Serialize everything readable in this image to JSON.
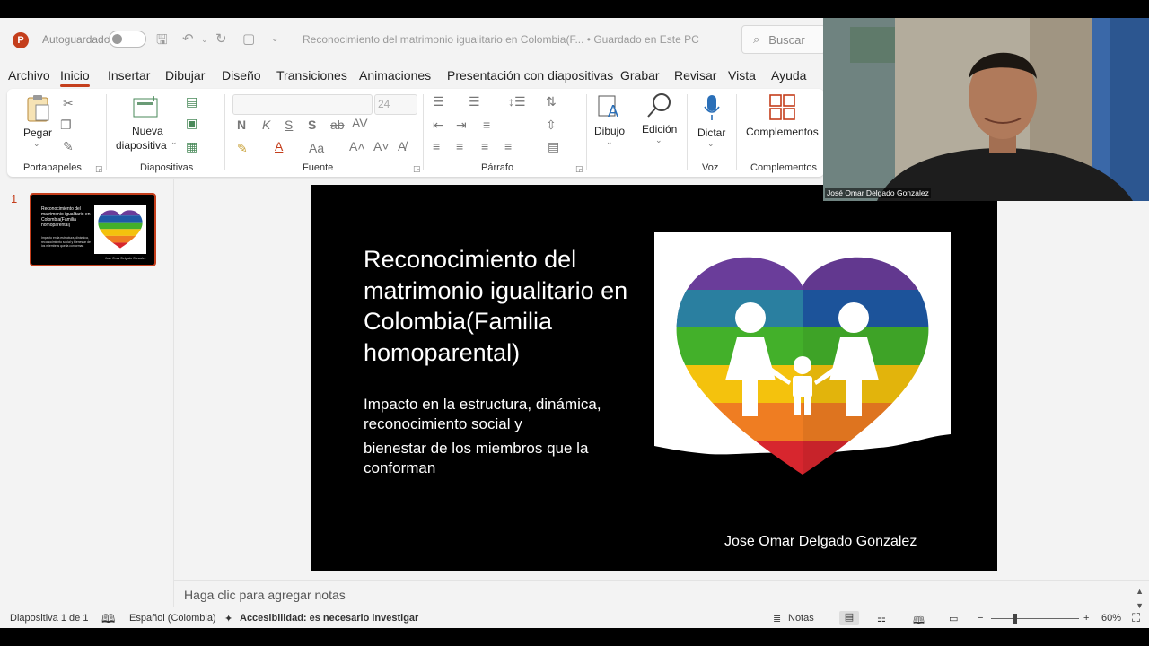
{
  "app": {
    "autosave_label": "Autoguardado",
    "document_title": "Reconocimiento del matrimonio igualitario en Colombia(F... • Guardado en Este PC",
    "search_label": "Buscar"
  },
  "tabs": [
    "Archivo",
    "Inicio",
    "Insertar",
    "Dibujar",
    "Diseño",
    "Transiciones",
    "Animaciones",
    "Presentación con diapositivas",
    "Grabar",
    "Revisar",
    "Vista",
    "Ayuda"
  ],
  "ribbon": {
    "paste_label": "Pegar",
    "new_slide_label_1": "Nueva",
    "new_slide_label_2": "diapositiva",
    "font_size": "24",
    "draw_label": "Dibujo",
    "edit_label": "Edición",
    "dictate_label": "Dictar",
    "addins_label": "Complementos",
    "groups": {
      "clipboard": "Portapapeles",
      "slides": "Diapositivas",
      "font": "Fuente",
      "paragraph": "Párrafo",
      "voice": "Voz",
      "addins": "Complementos"
    }
  },
  "thumbnail": {
    "number": "1",
    "title": "Reconocimiento del matrimonio igualitario en Colombia(Familia homoparental)",
    "subtitle": "Impacto en la estructura, dinámica, reconocimiento social y bienestar de los miembros que la conforman",
    "author": "Jose Omar Delgado Gonzalez"
  },
  "slide": {
    "title": "Reconocimiento del matrimonio igualitario en Colombia(Familia homoparental)",
    "subtitle_line1": "Impacto en la estructura, dinámica, reconocimiento social y",
    "subtitle_line2": "bienestar de los miembros que la conforman",
    "author": "Jose Omar Delgado Gonzalez"
  },
  "notes_placeholder": "Haga clic para agregar notas",
  "status": {
    "slide_counter": "Diapositiva 1 de 1",
    "language": "Español (Colombia)",
    "accessibility": "Accesibilidad: es necesario investigar",
    "notes_button": "Notas",
    "zoom": "60%"
  },
  "webcam": {
    "participant_name": "José Omar Delgado Gonzalez"
  },
  "colors": {
    "accent": "#c43e1c",
    "rainbow": [
      "#6a3d9a",
      "#1f5aa6",
      "#2a9d8f",
      "#43b02a",
      "#f4c20d",
      "#ef7d22",
      "#d7262e"
    ]
  }
}
